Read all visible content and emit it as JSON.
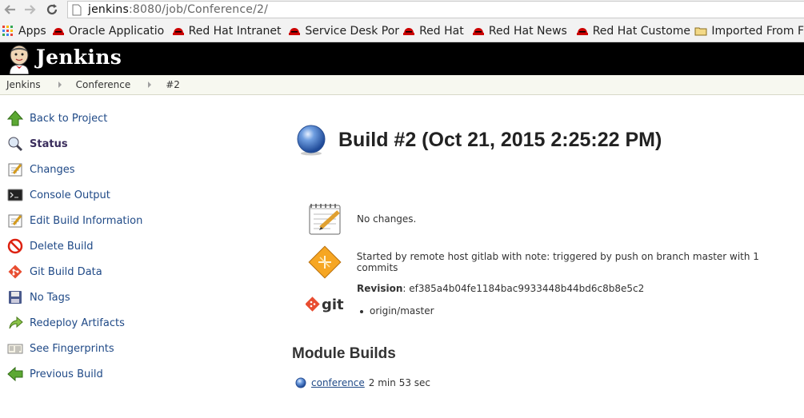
{
  "browser": {
    "url_host": "jenkins",
    "url_rest": ":8080/job/Conference/2/",
    "bookmarks": [
      {
        "label": "Apps",
        "icon": "apps-grid-icon"
      },
      {
        "label": "Oracle Applicatio",
        "icon": "redhat-icon"
      },
      {
        "label": "Red Hat Intranet",
        "icon": "redhat-icon"
      },
      {
        "label": "Service Desk Port",
        "icon": "redhat-icon"
      },
      {
        "label": "Red Hat",
        "icon": "redhat-icon"
      },
      {
        "label": "Red Hat News",
        "icon": "redhat-icon"
      },
      {
        "label": "Red Hat Custome",
        "icon": "redhat-icon"
      },
      {
        "label": "Imported From F",
        "icon": "folder-icon"
      }
    ]
  },
  "header": {
    "title": "Jenkins"
  },
  "breadcrumb": [
    "Jenkins",
    "Conference",
    "#2"
  ],
  "sidebar": {
    "items": [
      {
        "label": "Back to Project",
        "icon": "up-arrow-icon"
      },
      {
        "label": "Status",
        "icon": "magnifier-icon",
        "active": true
      },
      {
        "label": "Changes",
        "icon": "notepad-icon"
      },
      {
        "label": "Console Output",
        "icon": "terminal-icon"
      },
      {
        "label": "Edit Build Information",
        "icon": "notepad-icon"
      },
      {
        "label": "Delete Build",
        "icon": "no-entry-icon"
      },
      {
        "label": "Git Build Data",
        "icon": "git-icon"
      },
      {
        "label": "No Tags",
        "icon": "save-disk-icon"
      },
      {
        "label": "Redeploy Artifacts",
        "icon": "redeploy-arrow-icon"
      },
      {
        "label": "See Fingerprints",
        "icon": "fingerprint-card-icon"
      },
      {
        "label": "Previous Build",
        "icon": "left-arrow-icon"
      }
    ]
  },
  "main": {
    "title": "Build #2 (Oct 21, 2015 2:25:22 PM)",
    "changes": "No changes.",
    "cause": "Started by remote host gitlab with note: triggered by push on branch master with 1 commits",
    "revision_label": "Revision",
    "revision": ": ef385a4b04fe1184bac9933448b44bd6c8b8e5c2",
    "branches": [
      "origin/master"
    ],
    "git_logo_text": "git",
    "module_builds_heading": "Module Builds",
    "modules": [
      {
        "name": "conference",
        "duration": "2 min 53 sec"
      }
    ]
  },
  "colors": {
    "header_bg": "#000000",
    "breadcrumb_bg": "#f7f8f0",
    "link": "#204a87",
    "ball_blue": "#3f73c5"
  }
}
